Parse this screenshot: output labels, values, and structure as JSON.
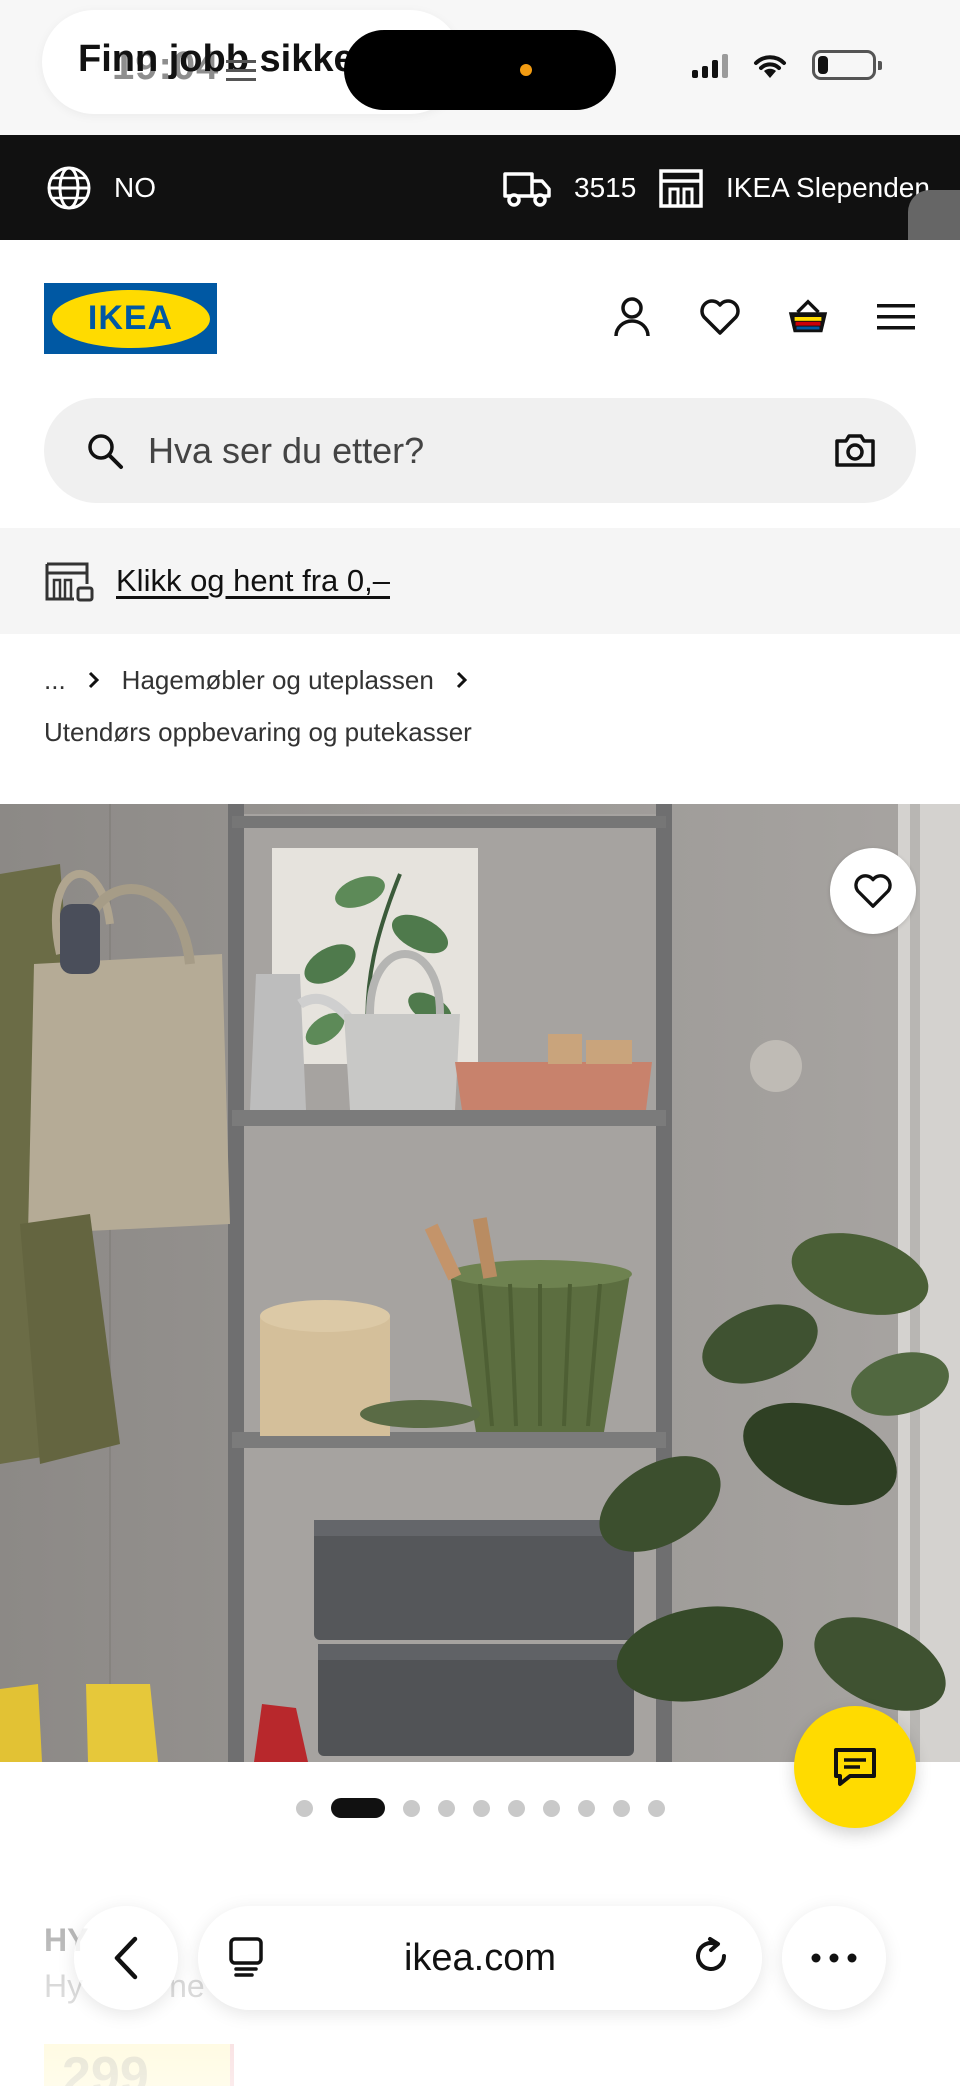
{
  "status_bar": {
    "time": "19:04",
    "notification_text": "Finn jobb sikker",
    "notification_icon": "menu-lines-icon"
  },
  "utility_bar": {
    "language": "NO",
    "postcode": "3515",
    "store": "IKEA Slependen",
    "colors": {
      "background": "#111111",
      "text": "#ffffff"
    }
  },
  "header": {
    "logo_text": "IKEA",
    "icons": [
      "user-icon",
      "heart-icon",
      "basket-icon",
      "menu-icon"
    ],
    "colors": {
      "logo_blue": "#0058a3",
      "logo_yellow": "#ffdb00"
    }
  },
  "search": {
    "placeholder": "Hva ser du etter?"
  },
  "pickup_banner": {
    "link_text": "Klikk og hent fra 0,–"
  },
  "breadcrumb": {
    "ellipsis": "...",
    "items": [
      "Hagemøbler og uteplassen",
      "Utendørs oppbevaring og putekasser"
    ]
  },
  "gallery": {
    "dot_count": 11,
    "active_index": 1
  },
  "product": {
    "title_partial": "HY",
    "subtitle_partial": "Hy",
    "subtitle_tail": "ne",
    "price_partial": "299"
  },
  "browser_toolbar": {
    "url": "ikea.com"
  },
  "accent_colors": {
    "ikea_yellow": "#ffdb00",
    "chat_button": "#ffdb00"
  }
}
